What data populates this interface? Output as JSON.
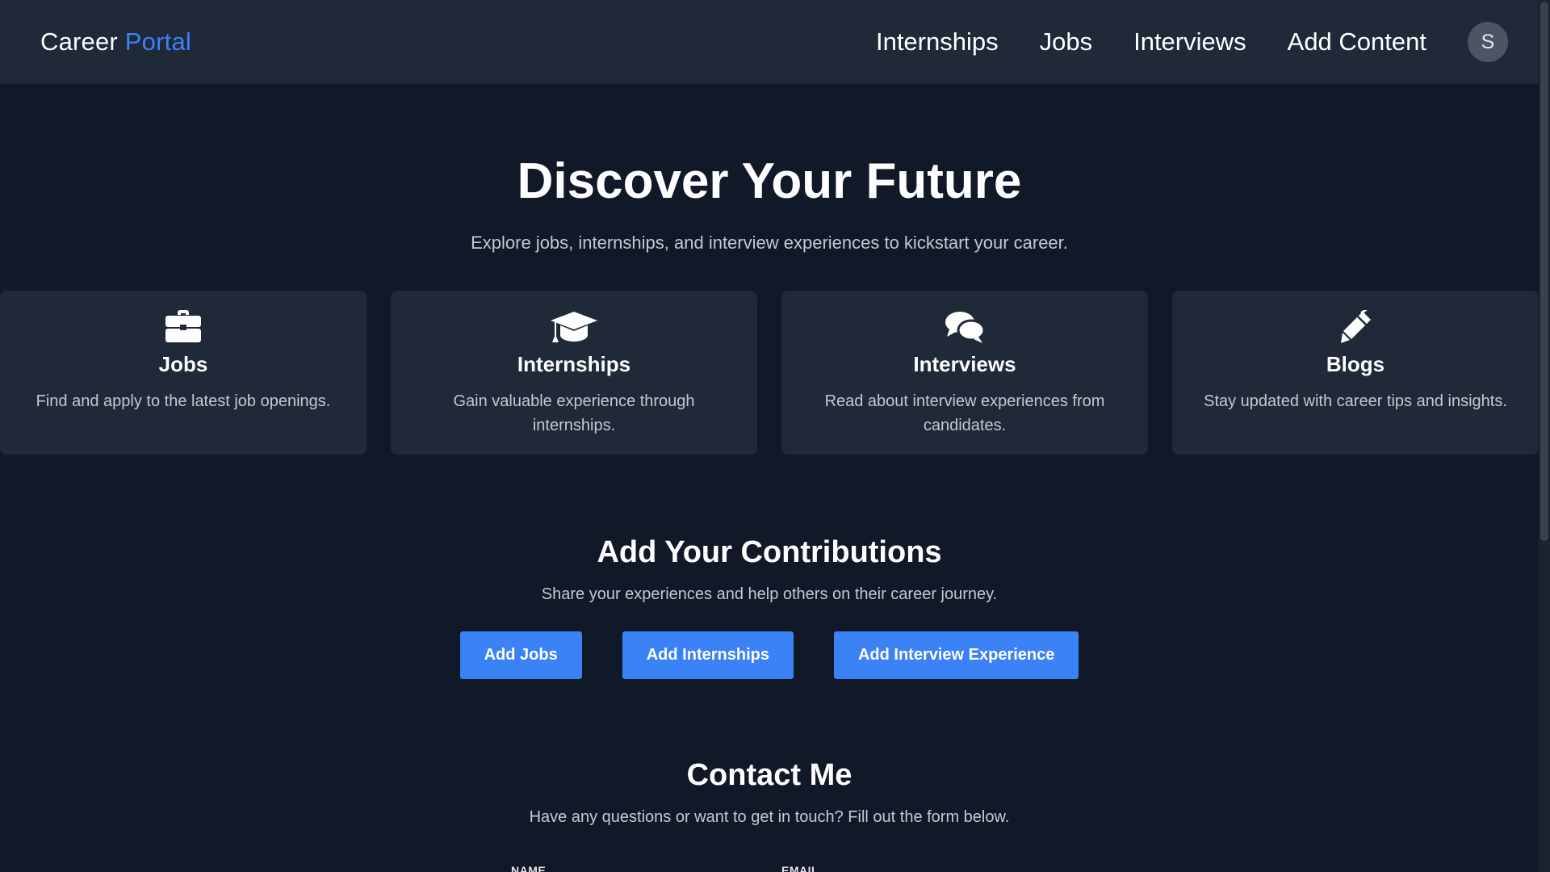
{
  "header": {
    "brand_primary": "Career",
    "brand_accent": "Portal",
    "nav": [
      "Internships",
      "Jobs",
      "Interviews",
      "Add Content"
    ],
    "avatar_initial": "S"
  },
  "hero": {
    "title": "Discover Your Future",
    "subtitle": "Explore jobs, internships, and interview experiences to kickstart your career."
  },
  "cards": [
    {
      "icon": "briefcase-icon",
      "title": "Jobs",
      "desc": "Find and apply to the latest job openings."
    },
    {
      "icon": "graduation-cap-icon",
      "title": "Internships",
      "desc": "Gain valuable experience through internships."
    },
    {
      "icon": "chat-bubbles-icon",
      "title": "Interviews",
      "desc": "Read about interview experiences from candidates."
    },
    {
      "icon": "pen-icon",
      "title": "Blogs",
      "desc": "Stay updated with career tips and insights."
    }
  ],
  "contributions": {
    "title": "Add Your Contributions",
    "subtitle": "Share your experiences and help others on their career journey.",
    "buttons": [
      "Add Jobs",
      "Add Internships",
      "Add Interview Experience"
    ]
  },
  "contact": {
    "title": "Contact Me",
    "subtitle": "Have any questions or want to get in touch? Fill out the form below.",
    "name_label": "NAME",
    "email_label": "EMAIL"
  },
  "colors": {
    "background": "#111827",
    "surface": "#1f2937",
    "accent": "#3b82f6",
    "muted_text": "#c3c9d3"
  }
}
